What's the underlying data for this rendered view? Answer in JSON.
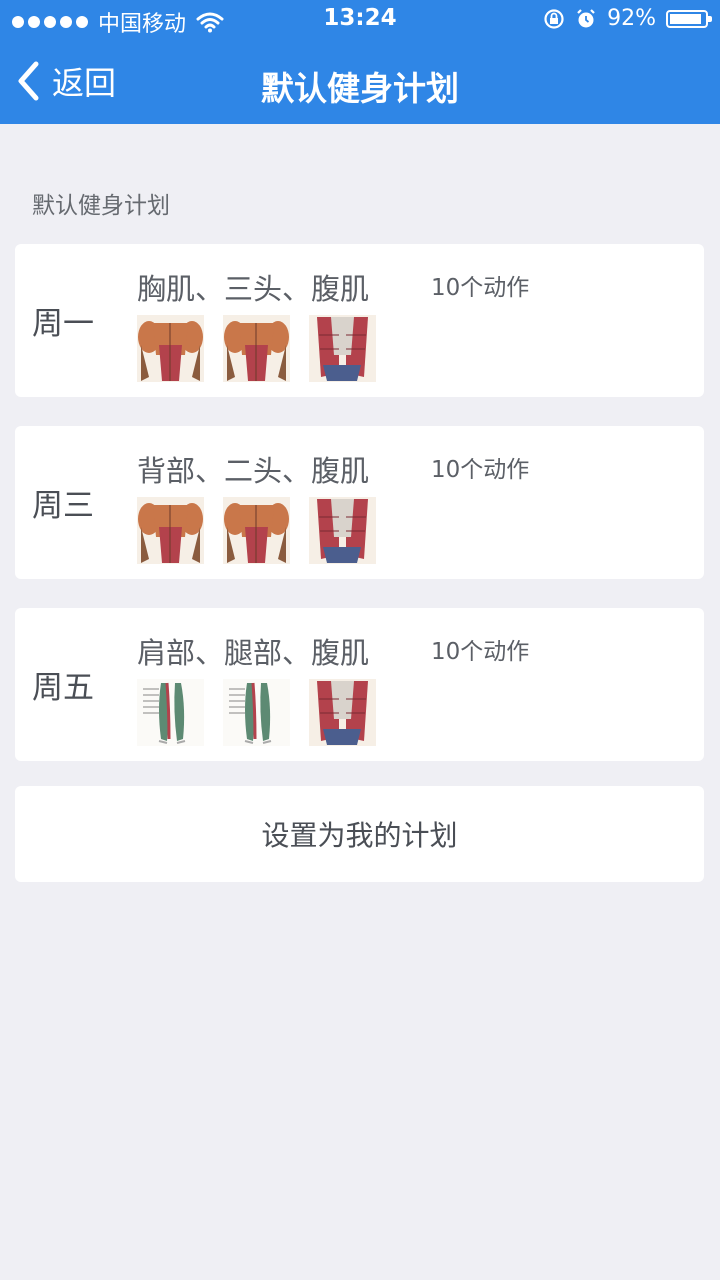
{
  "status_bar": {
    "carrier": "中国移动",
    "time": "13:24",
    "battery": "92%",
    "battery_level": 0.92
  },
  "nav": {
    "back_label": "返回",
    "title": "默认健身计划"
  },
  "section_label": "默认健身计划",
  "plans": [
    {
      "day": "周一",
      "muscles": "胸肌、三头、腹肌",
      "count": "10个动作",
      "thumbs": [
        "chest-muscle-image",
        "triceps-muscle-image",
        "abs-muscle-image"
      ]
    },
    {
      "day": "周三",
      "muscles": "背部、二头、腹肌",
      "count": "10个动作",
      "thumbs": [
        "back-muscle-image",
        "biceps-muscle-image",
        "abs-muscle-image"
      ]
    },
    {
      "day": "周五",
      "muscles": "肩部、腿部、腹肌",
      "count": "10个动作",
      "thumbs": [
        "leg-muscle-image",
        "leg-muscle-image",
        "abs-muscle-image"
      ]
    }
  ],
  "set_button_label": "设置为我的计划",
  "colors": {
    "header_blue": "#2f86e6",
    "background": "#efeff4",
    "muscle_red": "#b3424c",
    "muscle_orange": "#c9774a",
    "muscle_green": "#5d8a73"
  }
}
